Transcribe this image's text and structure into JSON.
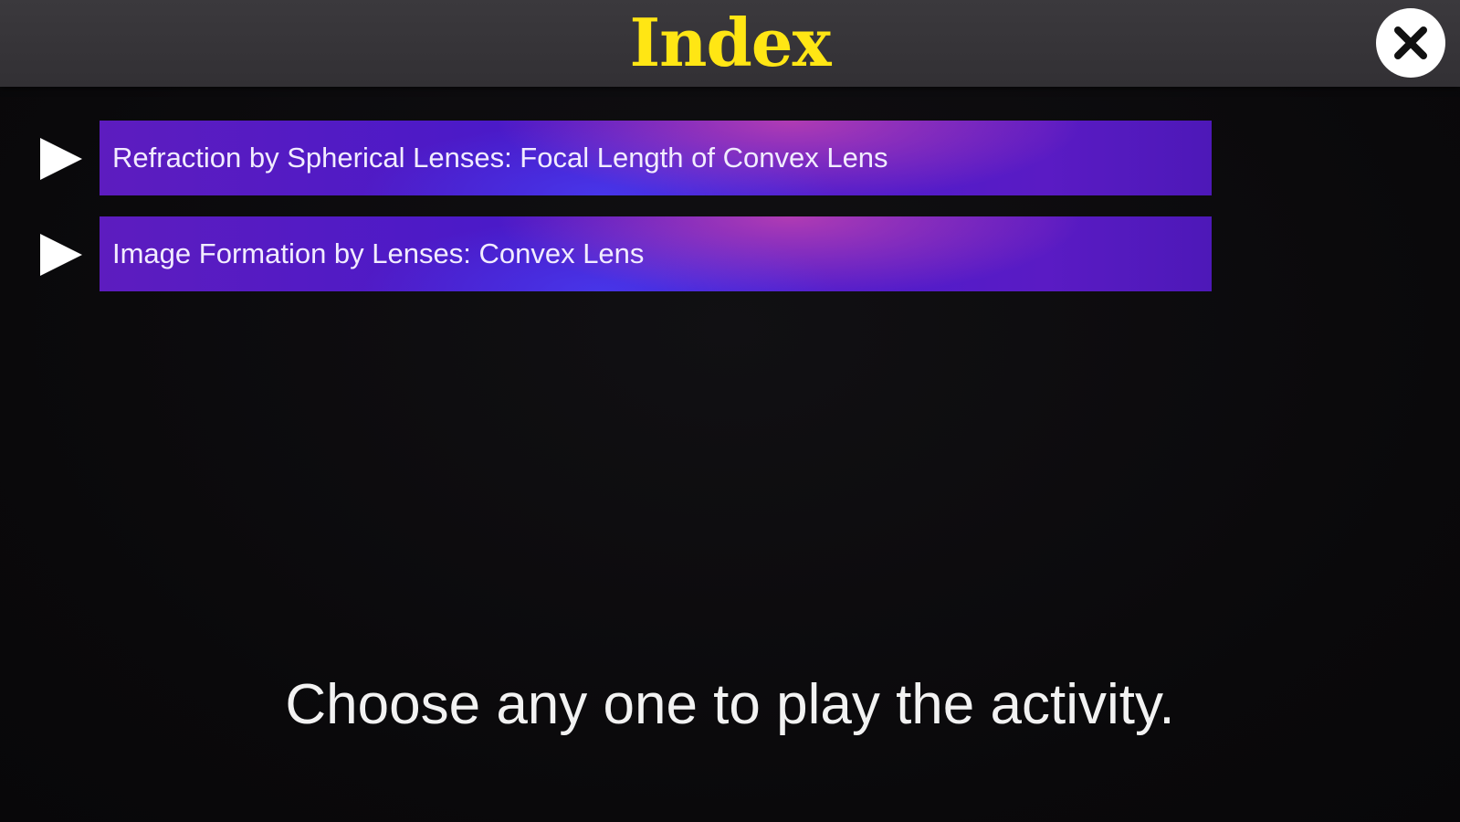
{
  "header": {
    "title": "Index",
    "close_icon": "close-icon"
  },
  "menu": {
    "items": [
      {
        "label": "Refraction by Spherical Lenses: Focal Length of Convex Lens",
        "icon": "play-icon"
      },
      {
        "label": "Image Formation by Lenses: Convex Lens",
        "icon": "play-icon"
      }
    ]
  },
  "footer": {
    "instruction": "Choose any one to play the activity."
  },
  "colors": {
    "title": "#ffe614",
    "header_bg": "#363438",
    "bar_primary": "#4b1ac8",
    "bar_highlight": "#d246aa",
    "background": "#0b0a0c"
  }
}
